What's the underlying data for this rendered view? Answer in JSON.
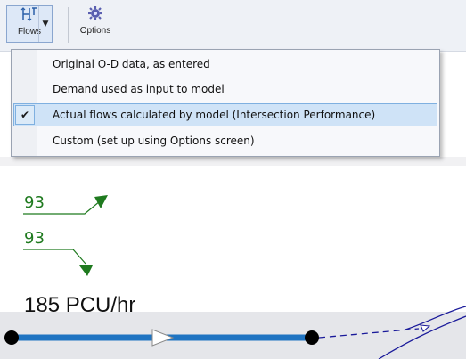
{
  "toolbar": {
    "flows_label": "Flows",
    "flows_icon": "flows-icon",
    "options_label": "Options",
    "options_icon": "gear-icon"
  },
  "flows_menu": {
    "items": [
      {
        "label": "Original O-D data, as entered",
        "checked": false
      },
      {
        "label": "Demand used as input to model",
        "checked": false
      },
      {
        "label": "Actual flows calculated by model (Intersection Performance)",
        "checked": true
      },
      {
        "label": "Custom (set up using Options screen)",
        "checked": false
      }
    ]
  },
  "diagram": {
    "flow_top": "93",
    "flow_bottom": "93",
    "link_flow": "185 PCU/hr"
  },
  "colors": {
    "flow_green": "#1f7a1f",
    "link_blue": "#1f74c2",
    "curve_navy": "#1a1a9a"
  }
}
